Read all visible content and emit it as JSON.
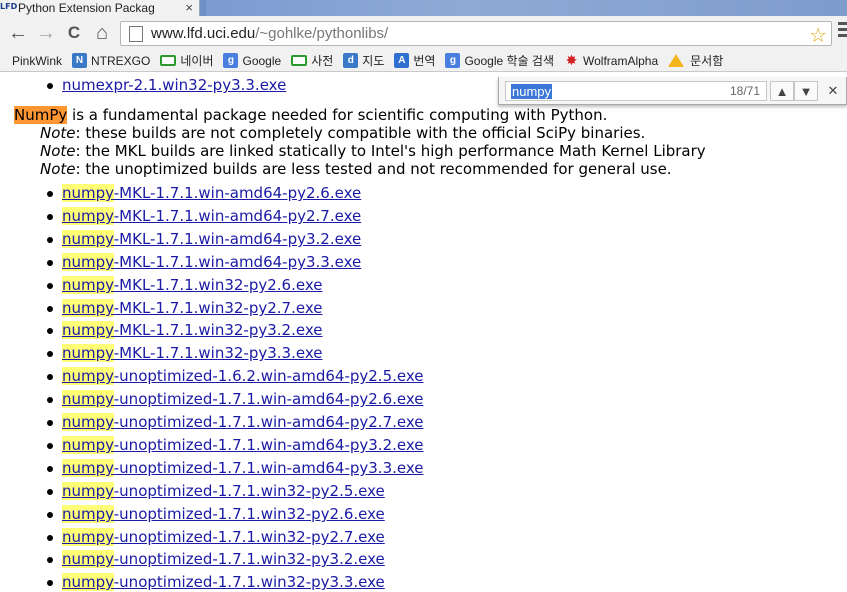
{
  "tab": {
    "favicon": "LFD",
    "title": "Python Extension Packag",
    "close": "×"
  },
  "toolbar": {
    "back": "←",
    "forward": "→",
    "reload": "C",
    "home": "⌂"
  },
  "address": {
    "host": "www.lfd.uci.edu",
    "path": "/~gohlke/pythonlibs/"
  },
  "bookmarks": [
    {
      "label": "PinkWink",
      "icon": "none"
    },
    {
      "label": "NTREXGO",
      "icon": "ntrexgo-icon"
    },
    {
      "label": "네이버",
      "icon": "naver-icon"
    },
    {
      "label": "Google",
      "icon": "google-icon"
    },
    {
      "label": "사전",
      "icon": "dictionary-icon"
    },
    {
      "label": "지도",
      "icon": "map-icon"
    },
    {
      "label": "번역",
      "icon": "translate-icon"
    },
    {
      "label": "Google 학술 검색",
      "icon": "google-scholar-icon"
    },
    {
      "label": "WolframAlpha",
      "icon": "wolframalpha-icon"
    },
    {
      "label": "문서함",
      "icon": "drive-icon"
    }
  ],
  "find": {
    "query": "numpy",
    "count": "18/71",
    "prev": "▲",
    "next": "▼",
    "close": "✕"
  },
  "content": {
    "prev_item": "numexpr-2.1.win32-py3.3.exe",
    "numpy_term": "NumPy",
    "desc": " is a fundamental package needed for scientific computing with Python.",
    "notes": [
      {
        "label": "Note",
        "text": ": these builds are not completely compatible with the official SciPy binaries."
      },
      {
        "label": "Note",
        "text": ": the MKL builds are linked statically to Intel's high performance Math Kernel Library"
      },
      {
        "label": "Note",
        "text": ": the unoptimized builds are less tested and not recommended for general use."
      }
    ],
    "files": [
      {
        "hl": "numpy",
        "rest": "-MKL-1.7.1.win-amd64-py2.6.exe"
      },
      {
        "hl": "numpy",
        "rest": "-MKL-1.7.1.win-amd64-py2.7.exe"
      },
      {
        "hl": "numpy",
        "rest": "-MKL-1.7.1.win-amd64-py3.2.exe"
      },
      {
        "hl": "numpy",
        "rest": "-MKL-1.7.1.win-amd64-py3.3.exe"
      },
      {
        "hl": "numpy",
        "rest": "-MKL-1.7.1.win32-py2.6.exe"
      },
      {
        "hl": "numpy",
        "rest": "-MKL-1.7.1.win32-py2.7.exe"
      },
      {
        "hl": "numpy",
        "rest": "-MKL-1.7.1.win32-py3.2.exe"
      },
      {
        "hl": "numpy",
        "rest": "-MKL-1.7.1.win32-py3.3.exe"
      },
      {
        "hl": "numpy",
        "rest": "-unoptimized-1.6.2.win-amd64-py2.5.exe"
      },
      {
        "hl": "numpy",
        "rest": "-unoptimized-1.7.1.win-amd64-py2.6.exe"
      },
      {
        "hl": "numpy",
        "rest": "-unoptimized-1.7.1.win-amd64-py2.7.exe"
      },
      {
        "hl": "numpy",
        "rest": "-unoptimized-1.7.1.win-amd64-py3.2.exe"
      },
      {
        "hl": "numpy",
        "rest": "-unoptimized-1.7.1.win-amd64-py3.3.exe"
      },
      {
        "hl": "numpy",
        "rest": "-unoptimized-1.7.1.win32-py2.5.exe"
      },
      {
        "hl": "numpy",
        "rest": "-unoptimized-1.7.1.win32-py2.6.exe"
      },
      {
        "hl": "numpy",
        "rest": "-unoptimized-1.7.1.win32-py2.7.exe"
      },
      {
        "hl": "numpy",
        "rest": "-unoptimized-1.7.1.win32-py3.2.exe"
      },
      {
        "hl": "numpy",
        "rest": "-unoptimized-1.7.1.win32-py3.3.exe"
      }
    ]
  }
}
